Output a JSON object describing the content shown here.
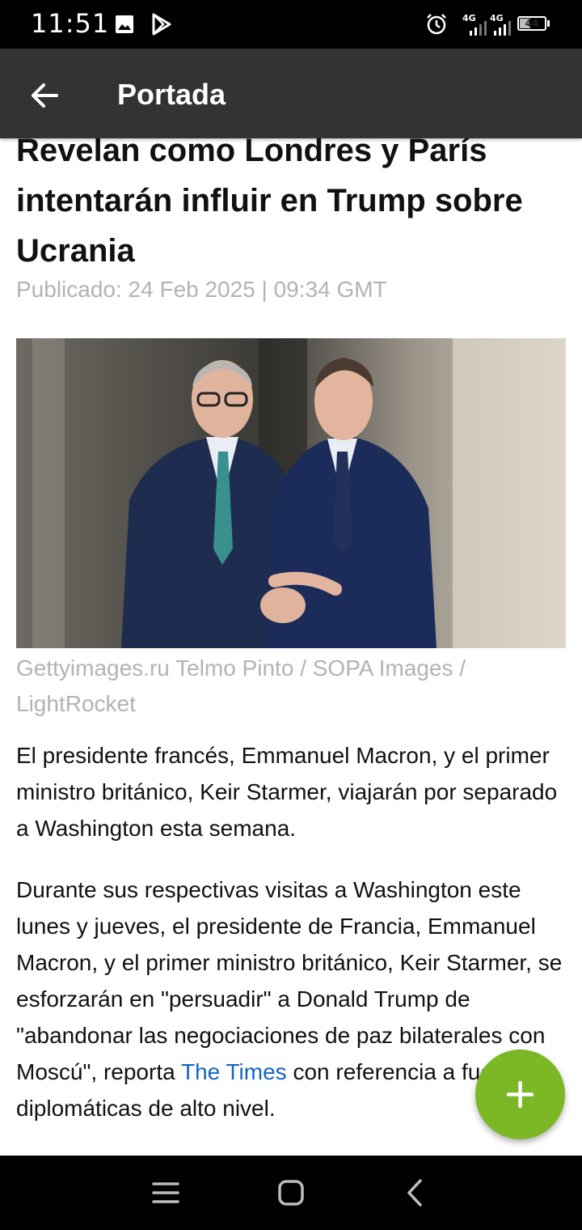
{
  "status_bar": {
    "time": "11:51",
    "icons": [
      "image-icon",
      "play-store-icon",
      "alarm-icon",
      "signal-4g-icon",
      "signal-4g-icon"
    ],
    "network_label_1": "4G",
    "network_label_2": "4G",
    "battery_level": "44",
    "battery_fraction": 0.44
  },
  "app_bar": {
    "title": "Portada",
    "back_icon": "arrow-left-icon"
  },
  "article": {
    "headline": "Revelan como Londres y París intentarán influir en Trump sobre Ucrania",
    "published": "Publicado: 24 Feb 2025 | 09:34 GMT",
    "image_caption": "Gettyimages.ru Telmo Pinto / SOPA Images / LightRocket",
    "paragraph_1": "El presidente francés, Emmanuel Macron, y el primer ministro británico, Keir Starmer, viajarán por separado a Washington esta semana.",
    "paragraph_2_before_link": "Durante sus respectivas visitas a Washington este lunes y jueves, el presidente de Francia, Emmanuel Macron, y el primer ministro británico, Keir Starmer, se esforzarán en \"persuadir\" a Donald Trump de \"abandonar las negociaciones de paz bilaterales con Moscú\", reporta ",
    "paragraph_2_link": "The Times",
    "paragraph_2_after_link": " con referencia a fuentes diplomáticas de alto nivel.",
    "link_color": "#1565c0"
  },
  "fab": {
    "icon": "plus-icon",
    "color": "#7cb726"
  },
  "nav_bar": {
    "icons": [
      "menu-icon",
      "home-icon",
      "back-icon"
    ]
  }
}
